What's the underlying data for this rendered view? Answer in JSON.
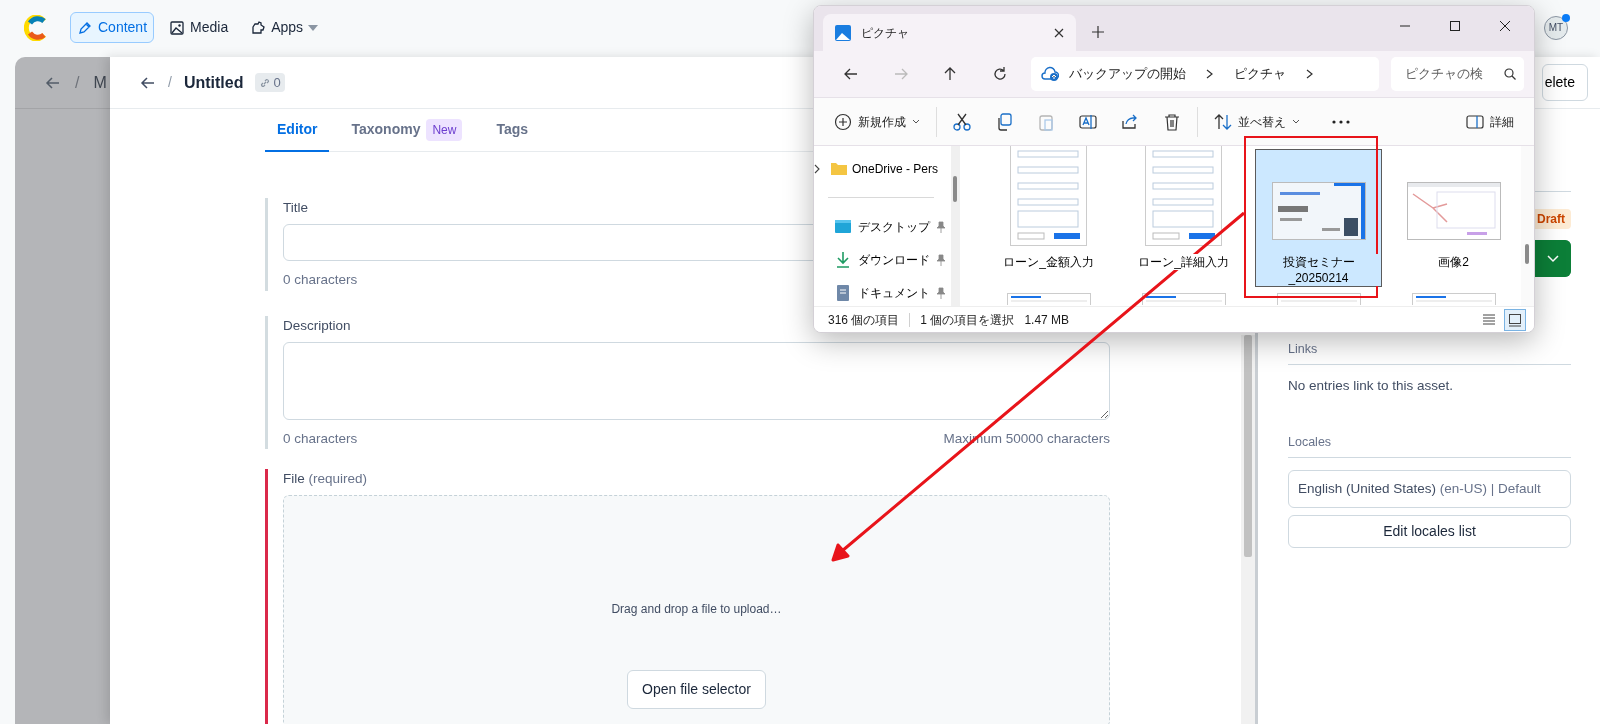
{
  "app_nav": {
    "items": [
      {
        "label": "Content",
        "selected": true,
        "dropdown": false
      },
      {
        "label": "Media",
        "selected": false,
        "dropdown": false
      },
      {
        "label": "Apps",
        "selected": false,
        "dropdown": true
      }
    ],
    "avatar": "MT",
    "notification": true
  },
  "background_entry": {
    "separator": "/",
    "breadcrumb": "M"
  },
  "entry": {
    "separator": "/",
    "title": "Untitled",
    "link_count": "0",
    "delete_label": "elete"
  },
  "tabs": [
    {
      "label": "Editor",
      "selected": true
    },
    {
      "label": "Taxonomy",
      "badge": "New",
      "selected": false
    },
    {
      "label": "Tags",
      "selected": false
    }
  ],
  "fields": [
    {
      "kind": "input",
      "label": "Title",
      "required": false,
      "counter": "0 characters"
    },
    {
      "kind": "textarea",
      "label": "Description",
      "required": false,
      "counter": "0 characters",
      "limit": "Maximum 50000 characters"
    },
    {
      "kind": "file",
      "label": "File",
      "required": true,
      "required_text": "(required)",
      "drop_text": "Drag and drop a file to upload…",
      "button": "Open file selector"
    }
  ],
  "sidebar": {
    "status": "Draft",
    "links_heading": "Links",
    "links_empty": "No entries link to this asset.",
    "locales_heading": "Locales",
    "locale": "English (United States)",
    "locale_suffix": "(en-US) | Default",
    "edit_locales": "Edit locales list"
  },
  "explorer": {
    "tab_title": "ピクチャ",
    "address": [
      "バックアップの開始",
      "ピクチャ"
    ],
    "search_placeholder": "ピクチャの検",
    "toolbar": [
      {
        "kind": "new",
        "label": "新規作成",
        "disabled": false
      },
      {
        "kind": "cut",
        "disabled": false
      },
      {
        "kind": "copy",
        "disabled": false
      },
      {
        "kind": "paste",
        "disabled": true
      },
      {
        "kind": "rename",
        "disabled": false
      },
      {
        "kind": "share",
        "disabled": false
      },
      {
        "kind": "delete",
        "disabled": false
      },
      {
        "kind": "sort",
        "label": "並べ替え",
        "disabled": false
      },
      {
        "kind": "more",
        "disabled": false
      },
      {
        "kind": "details",
        "label": "詳細",
        "disabled": false
      }
    ],
    "nav": [
      {
        "kind": "onedrive",
        "label": "OneDrive - Pers",
        "pinned": false
      },
      {
        "kind": "desktop",
        "label": "デスクトップ",
        "pinned": true
      },
      {
        "kind": "downloads",
        "label": "ダウンロード",
        "pinned": true
      },
      {
        "kind": "documents",
        "label": "ドキュメント",
        "pinned": true
      }
    ],
    "files": [
      {
        "kind": "form",
        "name": "ローン_金額入力",
        "selected": false
      },
      {
        "kind": "form",
        "name": "ローン_詳細入力",
        "selected": false
      },
      {
        "kind": "slide",
        "name": "投資セミナー_20250214",
        "selected": true
      },
      {
        "kind": "sheet",
        "name": "画像2",
        "selected": false
      }
    ],
    "item_count": "316 個の項目",
    "selection": "1 個の項目を選択",
    "selection_size": "1.47 MB",
    "views": [
      {
        "kind": "details",
        "selected": false
      },
      {
        "kind": "tiles",
        "selected": true
      }
    ]
  }
}
